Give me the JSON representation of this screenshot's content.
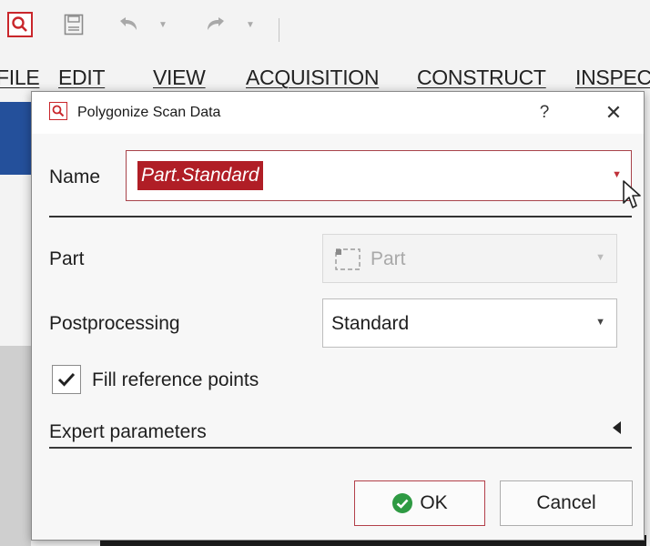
{
  "menu": {
    "file": "FILE",
    "edit": "EDIT",
    "view": "VIEW",
    "acquisition": "ACQUISITION",
    "construct": "CONSTRUCT",
    "inspect": "INSPEC"
  },
  "dialog": {
    "title": "Polygonize Scan Data",
    "help": "?",
    "close": "✕",
    "name_label": "Name",
    "name_value": "Part.Standard",
    "part_label": "Part",
    "part_value": "Part",
    "postprocessing_label": "Postprocessing",
    "postprocessing_value": "Standard",
    "fill_reference_label": "Fill reference points",
    "fill_reference_checked": true,
    "expert_label": "Expert parameters",
    "ok": "OK",
    "cancel": "Cancel"
  },
  "colors": {
    "accent": "#b01e26",
    "ok_green": "#2e9a43",
    "ribbon_blue": "#24509b"
  },
  "icons": [
    "search-icon",
    "save-icon",
    "undo-icon",
    "redo-icon",
    "chevron-down-icon",
    "part-icon",
    "check-icon",
    "expand-icon",
    "ok-check-icon",
    "mouse-cursor-icon"
  ]
}
